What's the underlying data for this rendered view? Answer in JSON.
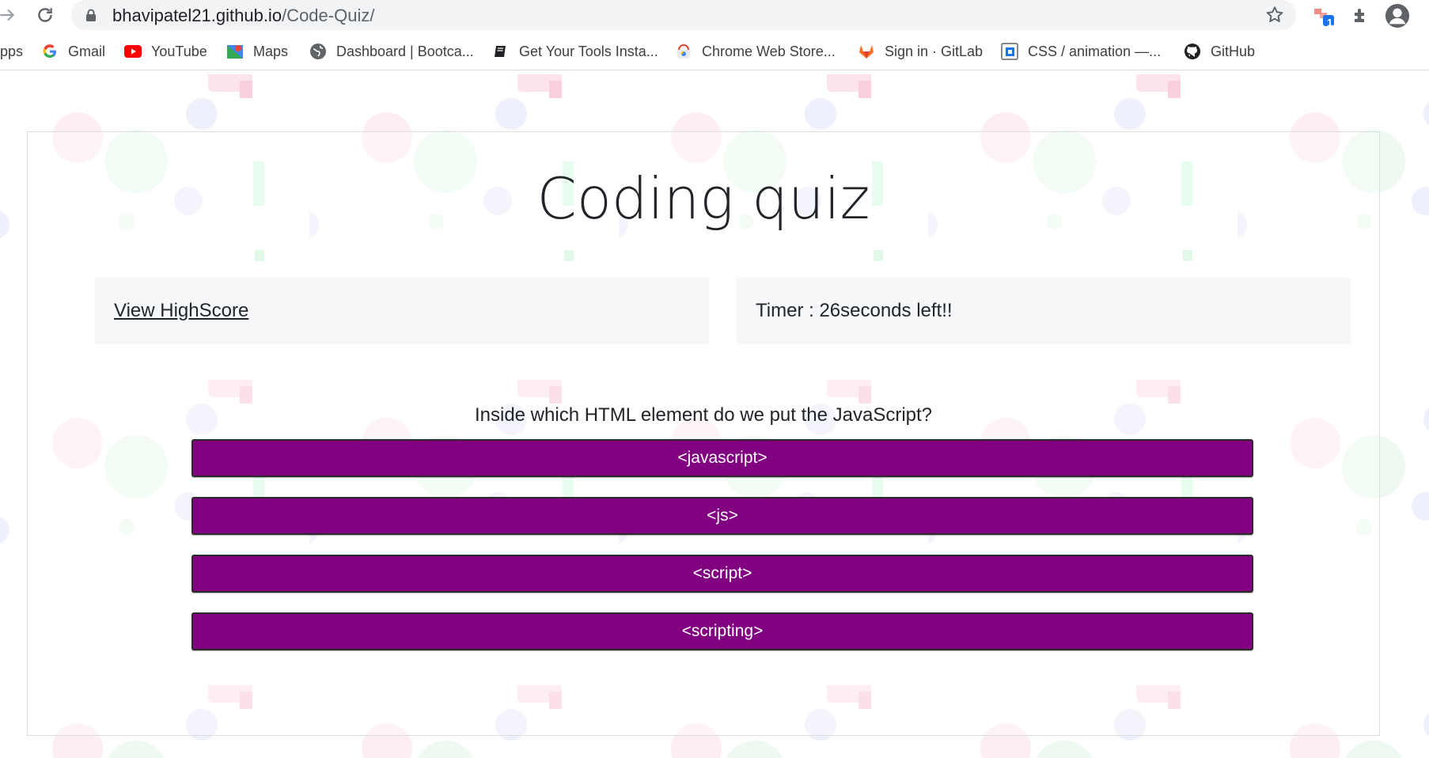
{
  "browser": {
    "url_host": "bhavipatel21.github.io",
    "url_path": "/Code-Quiz/",
    "extension_badge": "1",
    "bookmarks": [
      {
        "label": "pps",
        "icon": "apps-icon"
      },
      {
        "label": "Gmail",
        "icon": "google-icon"
      },
      {
        "label": "YouTube",
        "icon": "youtube-icon"
      },
      {
        "label": "Maps",
        "icon": "maps-icon"
      },
      {
        "label": "Dashboard | Bootca...",
        "icon": "globe-icon"
      },
      {
        "label": "Get Your Tools Insta...",
        "icon": "book-icon"
      },
      {
        "label": "Chrome Web Store...",
        "icon": "chrome-web-store-icon"
      },
      {
        "label": "Sign in · GitLab",
        "icon": "gitlab-icon"
      },
      {
        "label": "CSS / animation —...",
        "icon": "css-doc-icon"
      },
      {
        "label": "GitHub",
        "icon": "github-icon"
      }
    ]
  },
  "quiz": {
    "title": "Coding quiz",
    "highscore_link": "View HighScore",
    "timer_text": "Timer : 26seconds left!!",
    "question": "Inside which HTML element do we put the JavaScript?",
    "answers": [
      "<javascript>",
      "<js>",
      "<script>",
      "<scripting>"
    ]
  },
  "colors": {
    "answer_bg": "#800080",
    "answer_text": "#ffffff"
  }
}
